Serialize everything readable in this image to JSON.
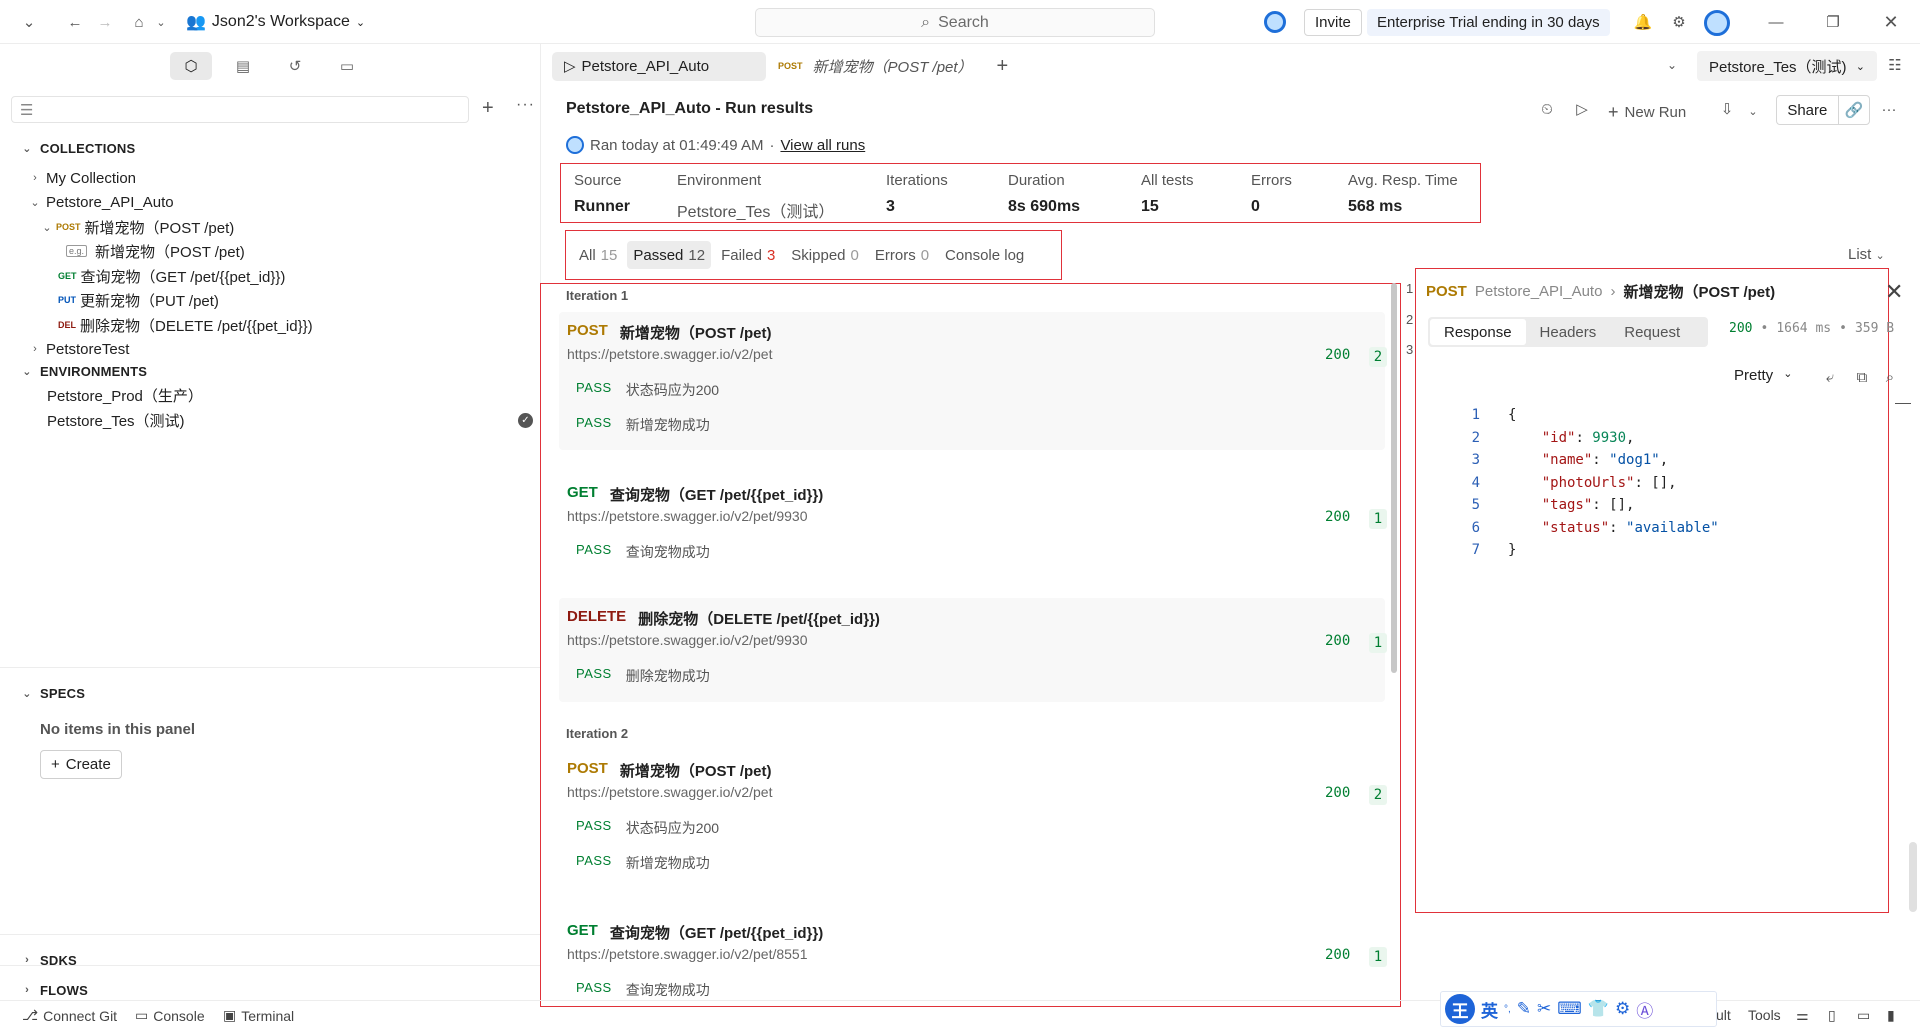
{
  "topbar": {
    "workspace": "Json2's Workspace",
    "search_placeholder": "Search",
    "invite": "Invite",
    "trial": "Enterprise Trial ending in 30 days"
  },
  "sidebar": {
    "filter_placeholder": "",
    "collections_label": "COLLECTIONS",
    "collections": [
      {
        "label": "My Collection"
      },
      {
        "label": "Petstore_API_Auto"
      },
      {
        "method": "POST",
        "label": "新增宠物（POST /pet)"
      },
      {
        "example": "e.g.",
        "label": "新增宠物（POST /pet)"
      },
      {
        "method": "GET",
        "label": "查询宠物（GET /pet/{{pet_id}})"
      },
      {
        "method": "PUT",
        "label": "更新宠物（PUT /pet)"
      },
      {
        "method": "DEL",
        "label": "删除宠物（DELETE /pet/{{pet_id}})"
      },
      {
        "label": "PetstoreTest"
      }
    ],
    "environments_label": "ENVIRONMENTS",
    "environments": [
      "Petstore_Prod（生产）",
      "Petstore_Tes（测试)"
    ],
    "specs_label": "SPECS",
    "specs_empty": "No items in this panel",
    "create": "Create",
    "sdks_label": "SDKS",
    "flows_label": "FLOWS"
  },
  "tabs": {
    "run_tab": "Petstore_API_Auto",
    "req_tab_method": "POST",
    "req_tab": "新增宠物（POST /pet）",
    "env": "Petstore_Tes（测试)"
  },
  "run": {
    "title": "Petstore_API_Auto - Run results",
    "ran": "Ran today at 01:49:49 AM",
    "sep": "·",
    "view_all": "View all runs",
    "new_run": "New Run",
    "share": "Share"
  },
  "stats": [
    {
      "key": "Source",
      "value": "Runner"
    },
    {
      "key": "Environment",
      "value": "Petstore_Tes（测试）"
    },
    {
      "key": "Iterations",
      "value": "3"
    },
    {
      "key": "Duration",
      "value": "8s 690ms"
    },
    {
      "key": "All tests",
      "value": "15"
    },
    {
      "key": "Errors",
      "value": "0"
    },
    {
      "key": "Avg. Resp. Time",
      "value": "568 ms"
    }
  ],
  "filters": [
    {
      "label": "All",
      "count": "15"
    },
    {
      "label": "Passed",
      "count": "12"
    },
    {
      "label": "Failed",
      "count": "3"
    },
    {
      "label": "Skipped",
      "count": "0"
    },
    {
      "label": "Errors",
      "count": "0"
    },
    {
      "label": "Console log",
      "count": ""
    }
  ],
  "list_view": "List",
  "iterations": [
    {
      "label": "Iteration 1",
      "requests": [
        {
          "method": "POST",
          "name": "新增宠物（POST /pet)",
          "url": "https://petstore.swagger.io/v2/pet",
          "code": "200",
          "count": "2",
          "asserts": [
            "状态码应为200",
            "新增宠物成功"
          ]
        },
        {
          "method": "GET",
          "name": "查询宠物（GET /pet/{{pet_id}})",
          "url": "https://petstore.swagger.io/v2/pet/9930",
          "code": "200",
          "count": "1",
          "asserts": [
            "查询宠物成功"
          ]
        },
        {
          "method": "DELETE",
          "name": "删除宠物（DELETE /pet/{{pet_id}})",
          "url": "https://petstore.swagger.io/v2/pet/9930",
          "code": "200",
          "count": "1",
          "asserts": [
            "删除宠物成功"
          ]
        }
      ]
    },
    {
      "label": "Iteration 2",
      "requests": [
        {
          "method": "POST",
          "name": "新增宠物（POST /pet)",
          "url": "https://petstore.swagger.io/v2/pet",
          "code": "200",
          "count": "2",
          "asserts": [
            "状态码应为200",
            "新增宠物成功"
          ]
        },
        {
          "method": "GET",
          "name": "查询宠物（GET /pet/{{pet_id}})",
          "url": "https://petstore.swagger.io/v2/pet/8551",
          "code": "200",
          "count": "1",
          "asserts": [
            "查询宠物成功"
          ]
        }
      ]
    }
  ],
  "pass_label": "PASS",
  "iteration_index": [
    "1",
    "2",
    "3"
  ],
  "detail": {
    "method": "POST",
    "collection": "Petstore_API_Auto",
    "name": "新增宠物（POST /pet)",
    "tabs": [
      "Response",
      "Headers",
      "Request"
    ],
    "status_code": "200",
    "time": "1664 ms",
    "size": "359 B",
    "format": "Pretty",
    "body_lines": [
      "{",
      "    \"id\": 9930,",
      "    \"name\": \"dog1\",",
      "    \"photoUrls\": [],",
      "    \"tags\": [],",
      "    \"status\": \"available\"",
      "}"
    ]
  },
  "statusbar": {
    "connect_git": "Connect Git",
    "console": "Console",
    "terminal": "Terminal",
    "ult": "ult",
    "tools": "Tools"
  },
  "ime": {
    "king": "王",
    "lang": "英"
  },
  "colors": {
    "accent_red": "#e0323a",
    "post": "#ad7a03",
    "get": "#007f31",
    "delete": "#8e1a10",
    "pass": "#007f31"
  }
}
